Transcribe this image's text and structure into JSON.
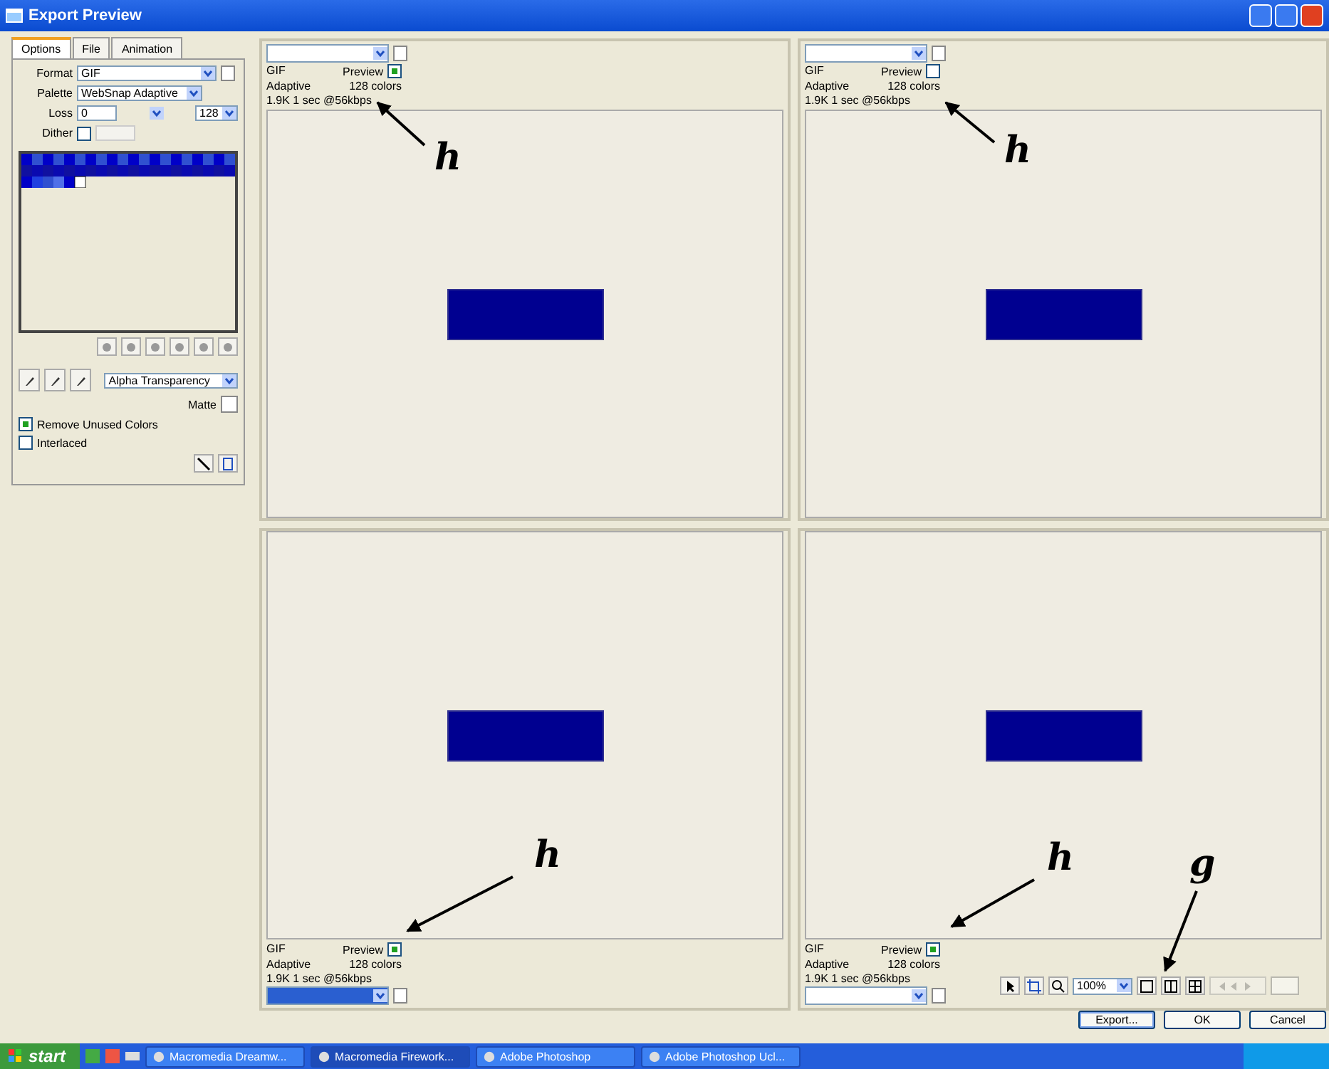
{
  "window": {
    "title": "Export Preview"
  },
  "tabs": [
    {
      "label": "Options",
      "selected": true
    },
    {
      "label": "File",
      "selected": false
    },
    {
      "label": "Animation",
      "selected": false
    }
  ],
  "options": {
    "format": {
      "label": "Format",
      "value": "GIF"
    },
    "palette": {
      "label": "Palette",
      "value": "WebSnap Adaptive"
    },
    "loss": {
      "label": "Loss",
      "value": "0"
    },
    "colors_count": "128",
    "dither": {
      "label": "Dither",
      "checked": false
    }
  },
  "transparency": "Alpha Transparency",
  "matte_label": "Matte",
  "checkboxes": [
    {
      "label": "Remove Unused Colors",
      "checked": true
    },
    {
      "label": "Interlaced",
      "checked": false
    }
  ],
  "panes": [
    {
      "format": "GIF",
      "preview_label": "Preview",
      "preview": true,
      "palette": "Adaptive",
      "colors": "128 colors",
      "size": "1.9K 1 sec @56kbps",
      "selected": false
    },
    {
      "format": "GIF",
      "preview_label": "Preview",
      "preview": false,
      "palette": "Adaptive",
      "colors": "128 colors",
      "size": "1.9K 1 sec @56kbps",
      "selected": false
    },
    {
      "format": "GIF",
      "preview_label": "Preview",
      "preview": true,
      "palette": "Adaptive",
      "colors": "128 colors",
      "size": "1.9K 1 sec @56kbps",
      "selected": true
    },
    {
      "format": "GIF",
      "preview_label": "Preview",
      "preview": true,
      "palette": "Adaptive",
      "colors": "128 colors",
      "size": "1.9K 1 sec @56kbps",
      "selected": false
    }
  ],
  "zoom": "100%",
  "buttons": [
    "Export...",
    "OK",
    "Cancel"
  ],
  "taskbar": {
    "start": "start",
    "items": [
      {
        "label": "Macromedia Dreamw...",
        "active": false
      },
      {
        "label": "Macromedia Firework...",
        "active": true
      },
      {
        "label": "Adobe Photoshop",
        "active": false
      },
      {
        "label": "Adobe Photoshop Ucl...",
        "active": false
      }
    ]
  },
  "annotations": [
    {
      "label": "h"
    },
    {
      "label": "h"
    },
    {
      "label": "h"
    },
    {
      "label": "h"
    },
    {
      "label": "g"
    }
  ]
}
